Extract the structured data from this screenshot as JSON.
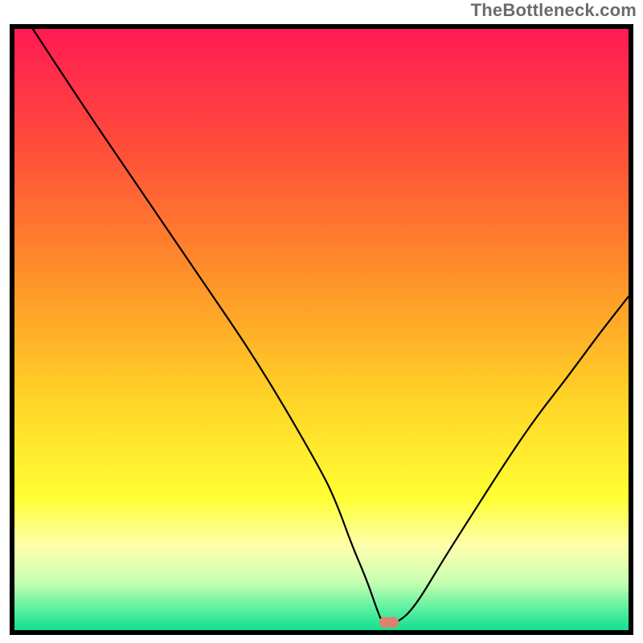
{
  "attribution": "TheBottleneck.com",
  "chart_data": {
    "type": "line",
    "title": "",
    "xlabel": "",
    "ylabel": "",
    "xlim": [
      0,
      100
    ],
    "ylim": [
      0,
      100
    ],
    "x": [
      3,
      10,
      20,
      30,
      40,
      50,
      52.5,
      55,
      57.5,
      59,
      60,
      62,
      65,
      70,
      75,
      80,
      85,
      90,
      95,
      100
    ],
    "values": [
      100,
      89,
      74,
      59,
      44,
      26.5,
      21,
      14,
      8,
      3.5,
      1.0,
      1.0,
      3.5,
      12,
      20,
      28,
      35.5,
      42,
      49,
      55.5
    ],
    "marker": {
      "x": 61,
      "y": 1.3
    },
    "gradient_stops": [
      {
        "offset": 0.0,
        "color": "#ff1a54"
      },
      {
        "offset": 0.2,
        "color": "#ff4e3a"
      },
      {
        "offset": 0.4,
        "color": "#ff8d2a"
      },
      {
        "offset": 0.6,
        "color": "#ffcf26"
      },
      {
        "offset": 0.78,
        "color": "#ffff33"
      },
      {
        "offset": 0.86,
        "color": "#feffad"
      },
      {
        "offset": 0.92,
        "color": "#c8ffb0"
      },
      {
        "offset": 0.965,
        "color": "#5af0a0"
      },
      {
        "offset": 1.0,
        "color": "#13e08f"
      }
    ]
  }
}
